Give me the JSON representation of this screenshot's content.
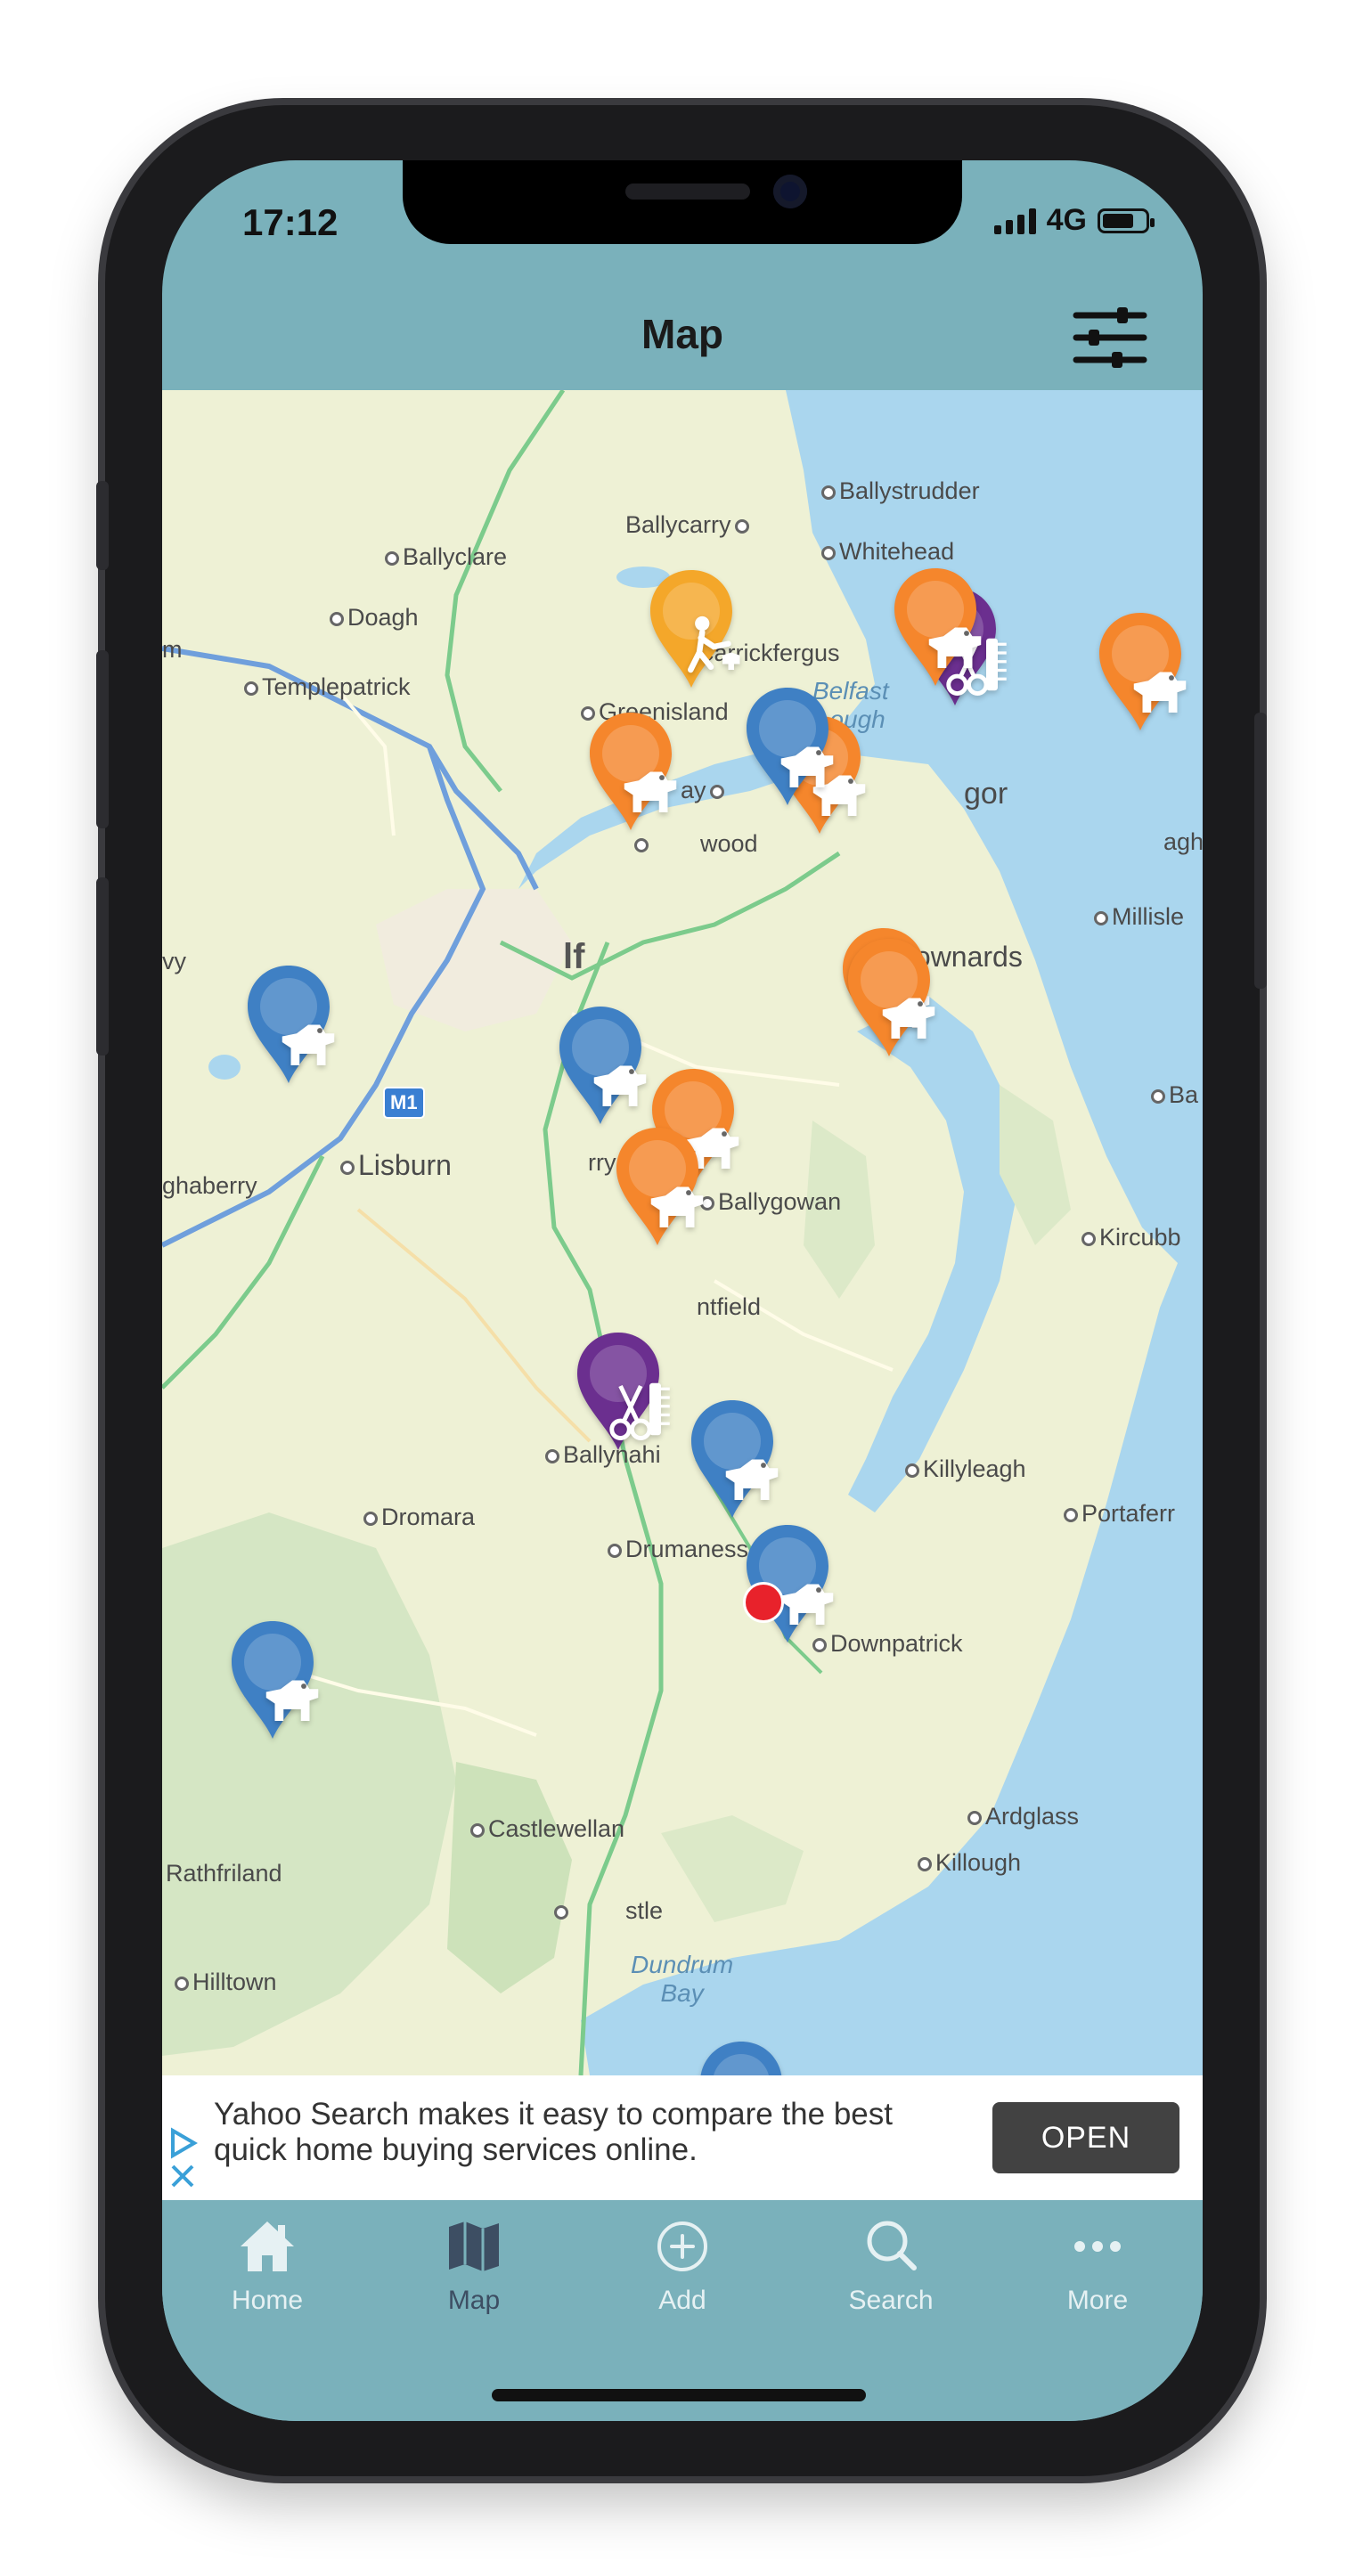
{
  "status_bar": {
    "time": "17:12",
    "network": "4G"
  },
  "header": {
    "title": "Map"
  },
  "map": {
    "places": {
      "ballystrudder": "Ballystrudder",
      "ballycarry": "Ballycarry",
      "whitehead": "Whitehead",
      "ballyclare": "Ballyclare",
      "doagh": "Doagh",
      "carrickfergus": "Carrickfergus",
      "templepatrick": "Templepatrick",
      "greenisland": "Greenisland",
      "he_ay": "He     ay",
      "wood": "wood",
      "gor": "gor",
      "agh": "agh",
      "millisle": "Millisle",
      "vy": "vy",
      "lf": "lf",
      "ytownards": "ytownards",
      "ba": "Ba",
      "lisburn": "Lisburn",
      "ghaberry": "ghaberry",
      "rryduff": "rryduff",
      "ballygowan": "Ballygowan",
      "kircubb": "Kircubb",
      "ntfield": "ntfield",
      "ballynahi": "Ballynahi",
      "killyleagh": "Killyleagh",
      "portaferr": "Portaferr",
      "dromara": "Dromara",
      "drumaness": "Drumaness",
      "downpatrick": "Downpatrick",
      "ardglass": "Ardglass",
      "killough": "Killough",
      "castlewellan": "Castlewellan",
      "rathfriland": "Rathfriland",
      "stle": "stle",
      "hilltown": "Hilltown",
      "m": "m"
    },
    "water_labels": {
      "belfast_lough": "Belfast\nLough",
      "dundrum_bay": "Dundrum\nBay"
    },
    "motorway": "M1",
    "pin_colors": {
      "orange": "#f5862c",
      "blue": "#3f80c4",
      "purple": "#6b2f8f",
      "yellow": "#f4a72a"
    },
    "pins": [
      {
        "color": "orange",
        "icon": "dog-icon"
      },
      {
        "color": "purple",
        "icon": "grooming-icon"
      },
      {
        "color": "orange",
        "icon": "dog-icon"
      },
      {
        "color": "yellow",
        "icon": "walker-icon"
      },
      {
        "color": "orange",
        "icon": "dog-icon"
      },
      {
        "color": "orange",
        "icon": "dog-icon"
      },
      {
        "color": "blue",
        "icon": "dog-icon"
      },
      {
        "color": "orange",
        "icon": "dog-icon"
      },
      {
        "color": "orange",
        "icon": "dog-icon"
      },
      {
        "color": "orange",
        "icon": "dog-icon"
      },
      {
        "color": "blue",
        "icon": "dog-icon"
      },
      {
        "color": "blue",
        "icon": "dog-icon"
      },
      {
        "color": "orange",
        "icon": "dog-icon"
      },
      {
        "color": "purple",
        "icon": "grooming-icon"
      },
      {
        "color": "blue",
        "icon": "dog-icon"
      },
      {
        "color": "blue",
        "icon": "dog-icon"
      },
      {
        "color": "blue",
        "icon": "dog-icon"
      },
      {
        "color": "blue",
        "icon": "dog-icon"
      }
    ]
  },
  "ad": {
    "text": "Yahoo Search makes it easy to compare the best quick home buying services online.",
    "button": "OPEN"
  },
  "tabbar": {
    "items": [
      {
        "label": "Home",
        "icon": "home-icon"
      },
      {
        "label": "Map",
        "icon": "map-icon"
      },
      {
        "label": "Add",
        "icon": "add-icon"
      },
      {
        "label": "Search",
        "icon": "search-icon"
      },
      {
        "label": "More",
        "icon": "more-icon"
      }
    ]
  }
}
